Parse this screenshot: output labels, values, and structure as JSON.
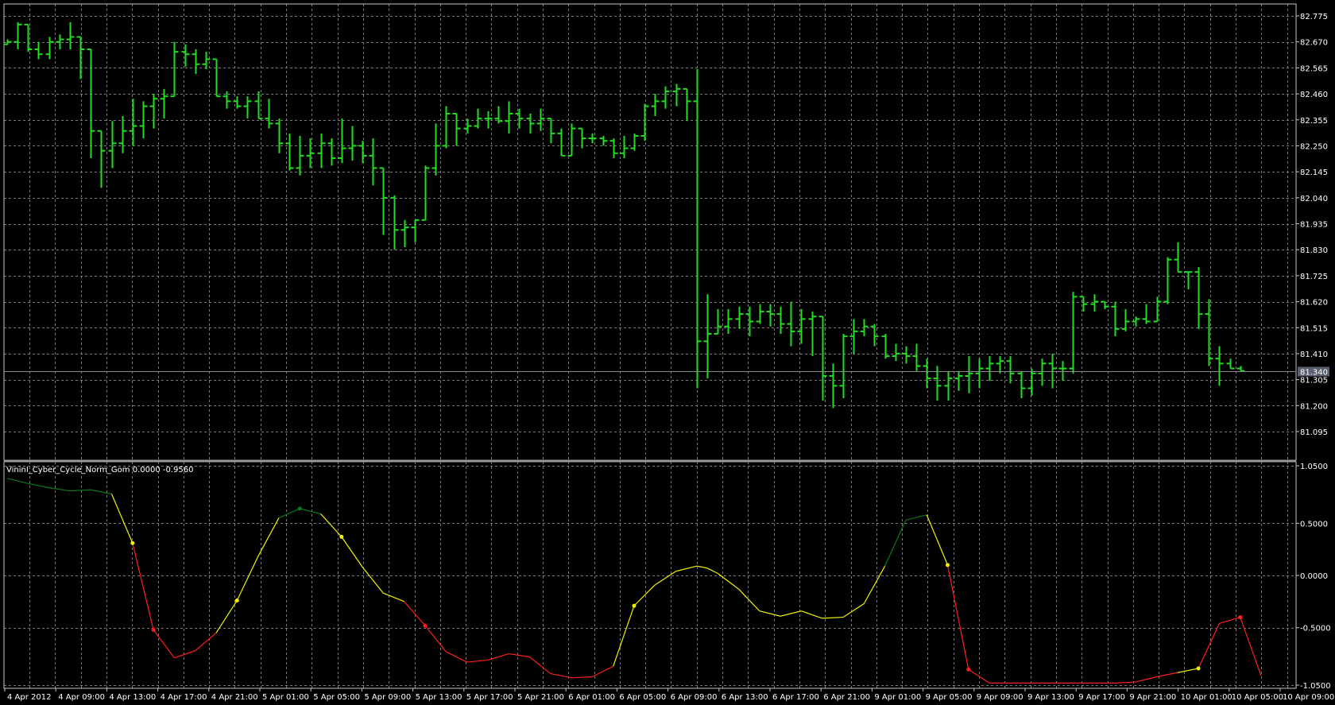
{
  "colors": {
    "background": "#000000",
    "grid": "#7a7a7a",
    "frame": "#c8c8c8",
    "bars": "#22dd22",
    "label_text": "#ffffff",
    "current_price_bg": "#5a6070",
    "ind_green": "#0b7a1c",
    "ind_yellow": "#f2f200",
    "ind_red": "#ff1e1e"
  },
  "chart_data": [
    {
      "type": "ohlc",
      "series_name": "",
      "price_ticks": [
        "82.775",
        "82.670",
        "82.565",
        "82.460",
        "82.355",
        "82.250",
        "82.145",
        "82.040",
        "81.935",
        "81.830",
        "81.725",
        "81.620",
        "81.515",
        "81.410",
        "81.305",
        "81.200",
        "81.095"
      ],
      "ylim": [
        81.04,
        82.79
      ],
      "current_price": "81.340",
      "x_tick_labels": [
        "4 Apr 2012",
        "4 Apr 09:00",
        "4 Apr 13:00",
        "4 Apr 17:00",
        "4 Apr 21:00",
        "5 Apr 01:00",
        "5 Apr 05:00",
        "5 Apr 09:00",
        "5 Apr 13:00",
        "5 Apr 17:00",
        "5 Apr 21:00",
        "6 Apr 01:00",
        "6 Apr 05:00",
        "6 Apr 09:00",
        "6 Apr 13:00",
        "6 Apr 17:00",
        "6 Apr 21:00",
        "9 Apr 01:00",
        "9 Apr 05:00",
        "9 Apr 09:00",
        "9 Apr 13:00",
        "9 Apr 17:00",
        "9 Apr 21:00",
        "10 Apr 01:00",
        "10 Apr 05:00",
        "10 Apr 09:00"
      ],
      "bars": [
        [
          82.66,
          82.68,
          82.66,
          82.67
        ],
        [
          82.67,
          82.75,
          82.64,
          82.74
        ],
        [
          82.74,
          82.74,
          82.63,
          82.64
        ],
        [
          82.64,
          82.67,
          82.6,
          82.62
        ],
        [
          82.62,
          82.69,
          82.6,
          82.67
        ],
        [
          82.67,
          82.7,
          82.64,
          82.68
        ],
        [
          82.68,
          82.75,
          82.64,
          82.69
        ],
        [
          82.69,
          82.69,
          82.52,
          82.64
        ],
        [
          82.64,
          82.64,
          82.2,
          82.31
        ],
        [
          82.31,
          82.31,
          82.08,
          82.23
        ],
        [
          82.23,
          82.35,
          82.16,
          82.26
        ],
        [
          82.26,
          82.37,
          82.22,
          82.31
        ],
        [
          82.31,
          82.44,
          82.25,
          82.33
        ],
        [
          82.33,
          82.43,
          82.28,
          82.41
        ],
        [
          82.41,
          82.46,
          82.32,
          82.44
        ],
        [
          82.44,
          82.48,
          82.36,
          82.45
        ],
        [
          82.45,
          82.67,
          82.45,
          82.63
        ],
        [
          82.63,
          82.66,
          82.57,
          82.62
        ],
        [
          82.62,
          82.64,
          82.54,
          82.58
        ],
        [
          82.58,
          82.63,
          82.56,
          82.6
        ],
        [
          82.6,
          82.6,
          82.45,
          82.45
        ],
        [
          82.45,
          82.47,
          82.4,
          82.43
        ],
        [
          82.43,
          82.45,
          82.4,
          82.41
        ],
        [
          82.41,
          82.45,
          82.36,
          82.43
        ],
        [
          82.43,
          82.47,
          82.38,
          82.36
        ],
        [
          82.36,
          82.44,
          82.32,
          82.34
        ],
        [
          82.34,
          82.36,
          82.22,
          82.26
        ],
        [
          82.26,
          82.3,
          82.15,
          82.16
        ],
        [
          82.16,
          82.29,
          82.13,
          82.21
        ],
        [
          82.21,
          82.28,
          82.16,
          82.22
        ],
        [
          82.22,
          82.3,
          82.16,
          82.26
        ],
        [
          82.26,
          82.28,
          82.17,
          82.2
        ],
        [
          82.2,
          82.36,
          82.18,
          82.24
        ],
        [
          82.24,
          82.33,
          82.19,
          82.25
        ],
        [
          82.25,
          82.27,
          82.18,
          82.21
        ],
        [
          82.21,
          82.28,
          82.09,
          82.16
        ],
        [
          82.16,
          82.06,
          81.89,
          82.04
        ],
        [
          82.04,
          82.05,
          81.83,
          81.91
        ],
        [
          81.91,
          81.95,
          81.84,
          81.92
        ],
        [
          81.92,
          81.95,
          81.86,
          81.95
        ],
        [
          81.95,
          82.17,
          81.95,
          82.16
        ],
        [
          82.16,
          82.34,
          82.13,
          82.25
        ],
        [
          82.25,
          82.41,
          82.24,
          82.38
        ],
        [
          82.38,
          82.38,
          82.25,
          82.32
        ],
        [
          82.32,
          82.36,
          82.3,
          82.33
        ],
        [
          82.33,
          82.4,
          82.32,
          82.36
        ],
        [
          82.36,
          82.39,
          82.32,
          82.36
        ],
        [
          82.36,
          82.41,
          82.34,
          82.35
        ],
        [
          82.35,
          82.43,
          82.3,
          82.38
        ],
        [
          82.38,
          82.4,
          82.32,
          82.36
        ],
        [
          82.36,
          82.38,
          82.3,
          82.34
        ],
        [
          82.34,
          82.4,
          82.31,
          82.36
        ],
        [
          82.36,
          82.36,
          82.26,
          82.3
        ],
        [
          82.3,
          82.32,
          82.21,
          82.21
        ],
        [
          82.21,
          82.34,
          82.21,
          82.32
        ],
        [
          82.32,
          82.32,
          82.24,
          82.28
        ],
        [
          82.28,
          82.3,
          82.26,
          82.28
        ],
        [
          82.28,
          82.29,
          82.25,
          82.27
        ],
        [
          82.27,
          82.28,
          82.2,
          82.22
        ],
        [
          82.22,
          82.29,
          82.2,
          82.24
        ],
        [
          82.24,
          82.3,
          82.23,
          82.29
        ],
        [
          82.29,
          82.42,
          82.27,
          82.41
        ],
        [
          82.41,
          82.46,
          82.37,
          82.43
        ],
        [
          82.43,
          82.49,
          82.4,
          82.47
        ],
        [
          82.47,
          82.5,
          82.41,
          82.48
        ],
        [
          82.48,
          82.45,
          82.35,
          82.43
        ],
        [
          82.43,
          82.56,
          81.27,
          81.46
        ],
        [
          81.46,
          81.65,
          81.31,
          81.49
        ],
        [
          81.49,
          81.59,
          81.5,
          81.52
        ],
        [
          81.52,
          81.59,
          81.49,
          81.55
        ],
        [
          81.55,
          81.6,
          81.51,
          81.57
        ],
        [
          81.57,
          81.6,
          81.48,
          81.54
        ],
        [
          81.54,
          81.61,
          81.53,
          81.58
        ],
        [
          81.58,
          81.61,
          81.52,
          81.57
        ],
        [
          81.57,
          81.6,
          81.49,
          81.53
        ],
        [
          81.53,
          81.62,
          81.44,
          81.5
        ],
        [
          81.5,
          81.59,
          81.45,
          81.55
        ],
        [
          81.55,
          81.58,
          81.4,
          81.56
        ],
        [
          81.56,
          81.35,
          81.22,
          81.32
        ],
        [
          81.32,
          81.37,
          81.19,
          81.28
        ],
        [
          81.28,
          81.49,
          81.23,
          81.48
        ],
        [
          81.48,
          81.55,
          81.41,
          81.5
        ],
        [
          81.5,
          81.55,
          81.48,
          81.52
        ],
        [
          81.52,
          81.53,
          81.44,
          81.48
        ],
        [
          81.48,
          81.49,
          81.39,
          81.4
        ],
        [
          81.4,
          81.45,
          81.38,
          81.41
        ],
        [
          81.41,
          81.44,
          81.37,
          81.4
        ],
        [
          81.4,
          81.45,
          81.34,
          81.36
        ],
        [
          81.36,
          81.39,
          81.27,
          81.31
        ],
        [
          81.31,
          81.36,
          81.22,
          81.28
        ],
        [
          81.28,
          81.34,
          81.22,
          81.31
        ],
        [
          81.31,
          81.34,
          81.26,
          81.32
        ],
        [
          81.32,
          81.4,
          81.25,
          81.33
        ],
        [
          81.33,
          81.39,
          81.27,
          81.35
        ],
        [
          81.35,
          81.4,
          81.3,
          81.37
        ],
        [
          81.37,
          81.4,
          81.33,
          81.38
        ],
        [
          81.38,
          81.4,
          81.29,
          81.33
        ],
        [
          81.33,
          81.34,
          81.23,
          81.27
        ],
        [
          81.27,
          81.35,
          81.24,
          81.33
        ],
        [
          81.33,
          81.39,
          81.28,
          81.37
        ],
        [
          81.37,
          81.41,
          81.27,
          81.35
        ],
        [
          81.35,
          81.38,
          81.3,
          81.35
        ],
        [
          81.35,
          81.66,
          81.33,
          81.64
        ],
        [
          81.64,
          81.64,
          81.58,
          81.61
        ],
        [
          81.61,
          81.65,
          81.58,
          81.62
        ],
        [
          81.62,
          81.59,
          81.59,
          81.6
        ],
        [
          81.6,
          81.62,
          81.48,
          81.51
        ],
        [
          81.51,
          81.59,
          81.5,
          81.54
        ],
        [
          81.54,
          81.56,
          81.52,
          81.55
        ],
        [
          81.55,
          81.61,
          81.53,
          81.54
        ],
        [
          81.54,
          81.64,
          81.54,
          81.62
        ],
        [
          81.62,
          81.8,
          81.61,
          81.79
        ],
        [
          81.79,
          81.86,
          81.76,
          81.74
        ],
        [
          81.74,
          81.74,
          81.67,
          81.74
        ],
        [
          81.74,
          81.76,
          81.51,
          81.57
        ],
        [
          81.57,
          81.63,
          81.36,
          81.39
        ],
        [
          81.39,
          81.44,
          81.28,
          81.37
        ],
        [
          81.37,
          81.39,
          81.35,
          81.35
        ],
        [
          81.35,
          81.36,
          81.34,
          81.34
        ]
      ]
    },
    {
      "type": "line",
      "title": "VininI_Cyber_Cycle_Norm_Gom 0.0000 -0.9560",
      "y_ticks": [
        "1.0500",
        "0.5000",
        "0.0000",
        "-0.5000",
        "-1.0500"
      ],
      "ylim": [
        -1.05,
        1.05
      ],
      "x": [
        0,
        2,
        4,
        6,
        8,
        10,
        12,
        14,
        16,
        18,
        20,
        22,
        24,
        26,
        28,
        30,
        32,
        34,
        36,
        38,
        40,
        42,
        44,
        46,
        48,
        50,
        52,
        54,
        56,
        58,
        60,
        62,
        64,
        66,
        67,
        68,
        70,
        72,
        74,
        76,
        78,
        80,
        82,
        84,
        86,
        88,
        90,
        92,
        94,
        96,
        98,
        100,
        102,
        104,
        106,
        108,
        110,
        112,
        114,
        116,
        118,
        120
      ],
      "values": [
        0.93,
        0.88,
        0.84,
        0.81,
        0.82,
        0.78,
        0.31,
        -0.52,
        -0.79,
        -0.72,
        -0.55,
        -0.24,
        0.18,
        0.55,
        0.64,
        0.59,
        0.37,
        0.08,
        -0.17,
        -0.25,
        -0.48,
        -0.73,
        -0.83,
        -0.81,
        -0.75,
        -0.78,
        -0.94,
        -0.98,
        -0.97,
        -0.87,
        -0.29,
        -0.09,
        0.04,
        0.09,
        0.07,
        0.02,
        -0.13,
        -0.34,
        -0.39,
        -0.34,
        -0.41,
        -0.4,
        -0.27,
        0.09,
        0.53,
        0.58,
        0.1,
        -0.9,
        -1.03,
        -1.03,
        -1.03,
        -1.03,
        -1.03,
        -1.03,
        -1.03,
        -1.02,
        -0.97,
        -0.93,
        -0.89,
        -0.46,
        -0.4,
        -0.96
      ],
      "segment_colors": [
        "green",
        "green",
        "green",
        "green",
        "green",
        "yellow",
        "red",
        "red",
        "red",
        "red",
        "yellow",
        "yellow",
        "yellow",
        "green",
        "green",
        "yellow",
        "yellow",
        "yellow",
        "yellow",
        "red",
        "red",
        "red",
        "red",
        "red",
        "red",
        "red",
        "red",
        "red",
        "red",
        "yellow",
        "yellow",
        "yellow",
        "yellow",
        "yellow",
        "yellow",
        "yellow",
        "yellow",
        "yellow",
        "yellow",
        "yellow",
        "yellow",
        "yellow",
        "yellow",
        "green",
        "green",
        "yellow",
        "red",
        "red",
        "red",
        "red",
        "red",
        "red",
        "red",
        "red",
        "red",
        "red",
        "red",
        "yellow",
        "red",
        "red",
        "red"
      ],
      "markers": [
        {
          "i": 6,
          "color": "yellow"
        },
        {
          "i": 7,
          "color": "red"
        },
        {
          "i": 11,
          "color": "yellow"
        },
        {
          "i": 14,
          "color": "green"
        },
        {
          "i": 16,
          "color": "yellow"
        },
        {
          "i": 20,
          "color": "red"
        },
        {
          "i": 30,
          "color": "yellow"
        },
        {
          "i": 46,
          "color": "yellow"
        },
        {
          "i": 47,
          "color": "red"
        },
        {
          "i": 58,
          "color": "yellow"
        },
        {
          "i": 60,
          "color": "red"
        }
      ]
    }
  ]
}
